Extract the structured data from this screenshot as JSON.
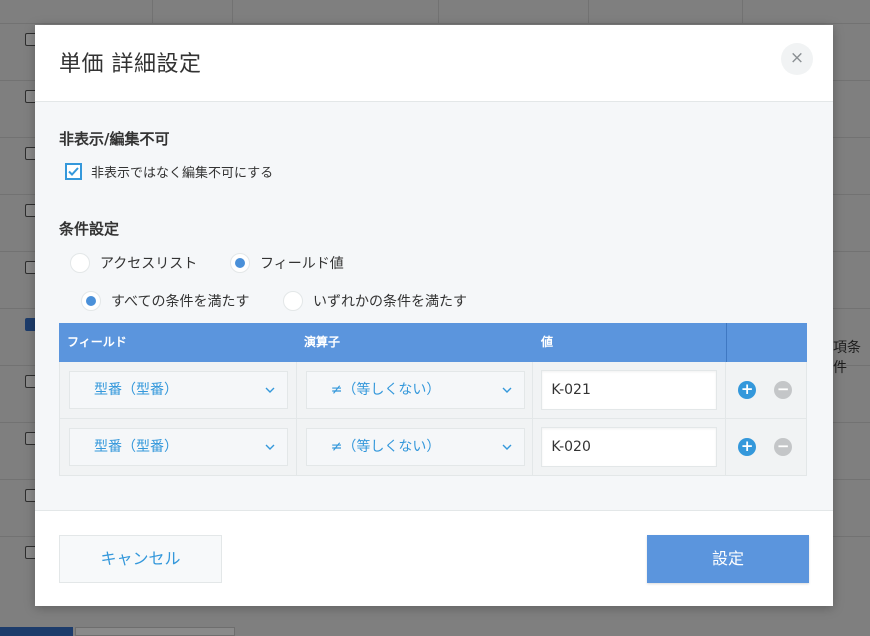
{
  "background": {
    "side_text": "項条件"
  },
  "dialog": {
    "title": "単価 詳細設定",
    "close_symbol": "×",
    "hide_section": {
      "title": "非表示/編集不可",
      "checkbox_label": "非表示ではなく編集不可にする",
      "checkbox_checked": true
    },
    "condition_section": {
      "title": "条件設定",
      "type_options": [
        {
          "label": "アクセスリスト",
          "selected": false
        },
        {
          "label": "フィールド値",
          "selected": true
        }
      ],
      "match_options": [
        {
          "label": "すべての条件を満たす",
          "selected": true
        },
        {
          "label": "いずれかの条件を満たす",
          "selected": false
        }
      ],
      "table": {
        "headers": [
          "フィールド",
          "演算子",
          "値",
          ""
        ],
        "rows": [
          {
            "field": "型番（型番）",
            "operator": "≠（等しくない）",
            "value": "K-021"
          },
          {
            "field": "型番（型番）",
            "operator": "≠（等しくない）",
            "value": "K-020"
          }
        ],
        "add_symbol": "+",
        "remove_symbol": "−"
      }
    },
    "buttons": {
      "cancel": "キャンセル",
      "ok": "設定"
    }
  },
  "colors": {
    "accent": "#3498db",
    "header_blue": "#5b95dd",
    "overlay": "#7f7f7f"
  }
}
